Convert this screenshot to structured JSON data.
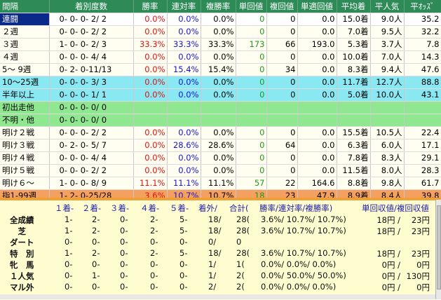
{
  "header": {
    "cols": [
      "間隔",
      "着別度数",
      "勝率",
      "連対率",
      "複勝率",
      "単回値",
      "複回値",
      "単適回値",
      "平均着",
      "平人気",
      "平ｵｯｽﾞ"
    ]
  },
  "rows": [
    {
      "label": "連闘",
      "dosu": "0- 0- 0- 2/ 2",
      "win": "0.0%",
      "ren": "0.0%",
      "fuku": "0.0%",
      "tan": "0",
      "fukuval": "0",
      "tekisei": "0.0",
      "avgpos": "15.0着",
      "avgpop": "9.0人",
      "avgodds": "35.2",
      "style": "sel"
    },
    {
      "label": "２週",
      "dosu": "0- 0- 0- 2/ 2",
      "win": "0.0%",
      "ren": "0.0%",
      "fuku": "0.0%",
      "tan": "0",
      "fukuval": "0",
      "tekisei": "0.0",
      "avgpos": "7.0着",
      "avgpop": "9.5人",
      "avgodds": "32.2",
      "style": "plain"
    },
    {
      "label": "３週",
      "dosu": "1- 0- 0- 2/ 3",
      "win": "33.3%",
      "ren": "33.3%",
      "fuku": "33.3%",
      "tan": "173",
      "fukuval": "66",
      "tekisei": "193.0",
      "avgpos": "5.3着",
      "avgpop": "3.7人",
      "avgodds": "7.8",
      "style": "plain"
    },
    {
      "label": "４週",
      "dosu": "0- 0- 0- 4/ 4",
      "win": "0.0%",
      "ren": "0.0%",
      "fuku": "0.0%",
      "tan": "0",
      "fukuval": "0",
      "tekisei": "0.0",
      "avgpos": "10.0着",
      "avgpop": "7.0人",
      "avgodds": "14.3",
      "style": "plain"
    },
    {
      "label": "5～ 9週",
      "dosu": "0- 2- 0-11/13",
      "win": "0.0%",
      "ren": "15.4%",
      "fuku": "15.4%",
      "tan": "0",
      "fukuval": "34",
      "tekisei": "0.0",
      "avgpos": "8.3着",
      "avgpop": "9.4人",
      "avgodds": "47.6",
      "style": "plain"
    },
    {
      "label": "10～25週",
      "dosu": "0- 0- 0- 3/ 3",
      "win": "0.0%",
      "ren": "0.0%",
      "fuku": "0.0%",
      "tan": "0",
      "fukuval": "0",
      "tekisei": "0.0",
      "avgpos": "11.7着",
      "avgpop": "12.7人",
      "avgodds": "88.8",
      "style": "cyan"
    },
    {
      "label": "半年以上",
      "dosu": "0- 0- 0- 1/ 1",
      "win": "0.0%",
      "ren": "0.0%",
      "fuku": "0.0%",
      "tan": "0",
      "fukuval": "0",
      "tekisei": "0.0",
      "avgpos": "5.0着",
      "avgpop": "10.0人",
      "avgodds": "43.1",
      "style": "cyan"
    },
    {
      "label": "初出走他",
      "dosu": "0- 0- 0- 0/ 0",
      "win": "",
      "ren": "",
      "fuku": "",
      "tan": "",
      "fukuval": "",
      "tekisei": "",
      "avgpos": "",
      "avgpop": "",
      "avgodds": "",
      "style": "lgreen"
    },
    {
      "label": "不明・他",
      "dosu": "0- 0- 0- 0/ 0",
      "win": "",
      "ren": "",
      "fuku": "",
      "tan": "",
      "fukuval": "",
      "tekisei": "",
      "avgpos": "",
      "avgpop": "",
      "avgodds": "",
      "style": "lgreen"
    },
    {
      "label": "明け２戦",
      "dosu": "0- 0- 0- 2/ 2",
      "win": "0.0%",
      "ren": "0.0%",
      "fuku": "0.0%",
      "tan": "0",
      "fukuval": "0",
      "tekisei": "0.0",
      "avgpos": "15.5着",
      "avgpop": "10.5人",
      "avgodds": "22.4",
      "style": "plain"
    },
    {
      "label": "明け３戦",
      "dosu": "0- 2- 0- 5/ 7",
      "win": "0.0%",
      "ren": "28.6%",
      "fuku": "28.6%",
      "tan": "0",
      "fukuval": "64",
      "tekisei": "0.0",
      "avgpos": "6.3着",
      "avgpop": "6.0人",
      "avgodds": "17.1",
      "style": "plain"
    },
    {
      "label": "明け４戦",
      "dosu": "0- 0- 0- 4/ 4",
      "win": "0.0%",
      "ren": "0.0%",
      "fuku": "0.0%",
      "tan": "0",
      "fukuval": "0",
      "tekisei": "0.0",
      "avgpos": "7.8着",
      "avgpop": "8.3人",
      "avgodds": "29.1",
      "style": "plain"
    },
    {
      "label": "明け５戦",
      "dosu": "0- 0- 0- 2/ 2",
      "win": "0.0%",
      "ren": "0.0%",
      "fuku": "0.0%",
      "tan": "0",
      "fukuval": "0",
      "tekisei": "0.0",
      "avgpos": "11.5着",
      "avgpop": "8.0人",
      "avgodds": "28.3",
      "style": "plain"
    },
    {
      "label": "明け６～",
      "dosu": "1- 0- 0- 8/ 9",
      "win": "11.1%",
      "ren": "11.1%",
      "fuku": "11.1%",
      "tan": "57",
      "fukuval": "22",
      "tekisei": "164.6",
      "avgpos": "8.8着",
      "avgpop": "9.8人",
      "avgodds": "61.7",
      "style": "plain"
    },
    {
      "label": "指1-99週",
      "dosu": "1- 2- 0-25/28",
      "win": "3.6%",
      "ren": "10.7%",
      "fuku": "10.7%",
      "tan": "18",
      "fukuval": "23",
      "tekisei": "47.9",
      "avgpos": "8.9着",
      "avgpop": "8.4人",
      "avgodds": "39.8",
      "style": "orange"
    }
  ],
  "summary": {
    "header": {
      "c1": "１着-",
      "c2": "２着-",
      "c3": "３着-",
      "c4": "４着-",
      "c5": "５着-",
      "c6": "着外/",
      "c7": "合計(",
      "c8": "勝率/連対率/複勝率)",
      "c9": "単回収値/複回収値"
    },
    "rows": [
      {
        "label": "全成績",
        "v1": "1-",
        "v2": "2-",
        "v3": "0-",
        "v4": "2-",
        "v5": "5-",
        "v6": "18/",
        "v7": "28(",
        "rate": "3.6%/ 10.7%/ 10.7%)",
        "tan": "18円 /",
        "fuku": "23円"
      },
      {
        "label": "　芝",
        "v1": "1-",
        "v2": "2-",
        "v3": "0-",
        "v4": "2-",
        "v5": "5-",
        "v6": "18/",
        "v7": "28(",
        "rate": "3.6%/ 10.7%/ 10.7%)",
        "tan": "18円 /",
        "fuku": "23円"
      },
      {
        "label": "ダート",
        "v1": "0-",
        "v2": "0-",
        "v3": "0-",
        "v4": "0-",
        "v5": "0-",
        "v6": "0/",
        "v7": "0",
        "rate": "",
        "tan": "",
        "fuku": ""
      },
      {
        "label": "特　別",
        "v1": "1-",
        "v2": "2-",
        "v3": "0-",
        "v4": "2-",
        "v5": "5-",
        "v6": "18/",
        "v7": "28(",
        "rate": "3.6%/ 10.7%/ 10.7%)",
        "tan": "18円 /",
        "fuku": "23円"
      },
      {
        "label": "牝　馬",
        "v1": "0-",
        "v2": "0-",
        "v3": "0-",
        "v4": "0-",
        "v5": "0-",
        "v6": "1/",
        "v7": "1(",
        "rate": "0.0%/  0.0%/  0.0%)",
        "tan": "0円 /",
        "fuku": "0円"
      },
      {
        "label": "１人気",
        "v1": "0-",
        "v2": "1-",
        "v3": "0-",
        "v4": "0-",
        "v5": "0-",
        "v6": "1/",
        "v7": "2(",
        "rate": "0.0%/ 50.0%/ 50.0%)",
        "tan": "0円 /",
        "fuku": "130円"
      },
      {
        "label": "マル外",
        "v1": "0-",
        "v2": "0-",
        "v3": "0-",
        "v4": "0-",
        "v5": "0-",
        "v6": "2/",
        "v7": "2(",
        "rate": "0.0%/  0.0%/  0.0%)",
        "tan": "0円 /",
        "fuku": "0円"
      }
    ]
  },
  "colors": {
    "header": "#2e8b57",
    "red": "#e01010",
    "blue": "#1414d8",
    "green": "#1a9a1a",
    "cyan": "#8ae8f2",
    "lightgreen": "#8fe88f",
    "orange": "#f6a060",
    "selected": "#0a2a8a"
  }
}
